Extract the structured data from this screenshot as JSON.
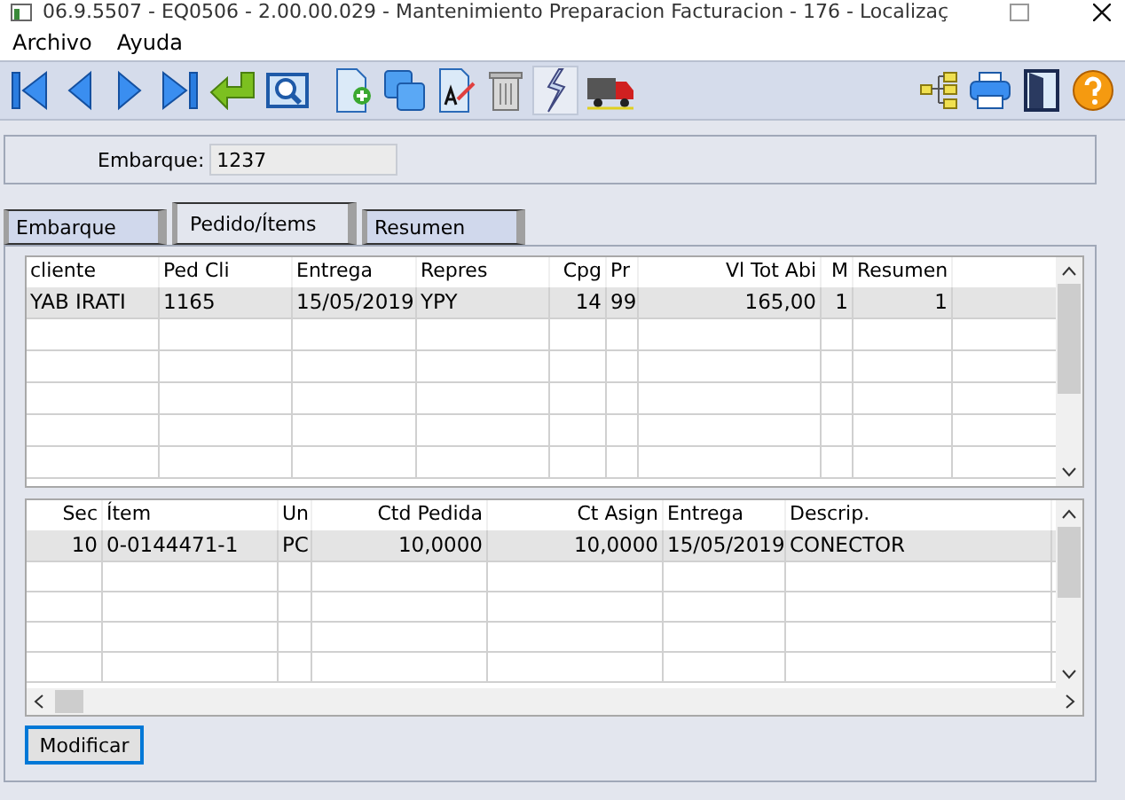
{
  "window": {
    "title": "06.9.5507 - EQ0506 - 2.00.00.029 - Mantenimiento Preparacion Facturacion - 176 - Localizaç"
  },
  "menu": [
    "Archivo",
    "Ayuda"
  ],
  "toolbar": [
    {
      "pressed": false
    },
    {
      "pressed": false
    },
    {
      "pressed": false
    },
    {
      "pressed": false
    },
    {
      "pressed": false
    },
    {
      "pressed": false
    },
    {
      "pressed": false
    },
    {
      "pressed": false
    },
    {
      "pressed": false
    },
    {
      "pressed": false
    },
    {
      "pressed": true
    },
    {
      "pressed": false
    }
  ],
  "embarque": {
    "label": "Embarque:",
    "value": "1237",
    "disabled": true
  },
  "tabs": [
    {
      "label": "Embarque",
      "selected": false
    },
    {
      "label": "Pedido/Ítems",
      "selected": true
    },
    {
      "label": "Resumen",
      "selected": false
    }
  ],
  "orders": {
    "columns": [
      "cliente",
      "Ped Cli",
      "Entrega",
      "Repres",
      "Cpg",
      "Pr",
      "Vl Tot Abi",
      "M",
      "Resumen"
    ],
    "rows": [
      {
        "cells": [
          "YAB IRATI",
          "1165",
          "15/05/2019",
          "YPY",
          "14",
          "99",
          "165,00",
          "1",
          "1"
        ],
        "selected": true
      }
    ]
  },
  "items": {
    "columns": [
      "Sec",
      "Ítem",
      "Un",
      "Ctd Pedida",
      "Ct Asign",
      "Entrega",
      "Descrip."
    ],
    "rows": [
      {
        "cells": [
          "10",
          "0-0144471-1",
          "PC",
          "10,0000",
          "10,0000",
          "15/05/2019",
          "CONECTOR"
        ],
        "selected": true
      }
    ]
  },
  "button": {
    "label": "Modificar",
    "focused": true
  }
}
